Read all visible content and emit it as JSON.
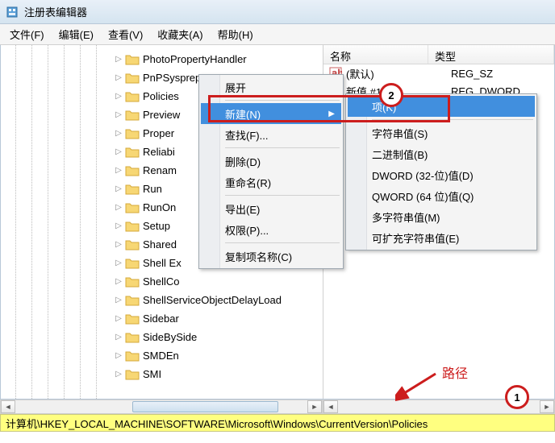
{
  "window": {
    "title": "注册表编辑器"
  },
  "menubar": {
    "file": "文件(F)",
    "edit": "编辑(E)",
    "view": "查看(V)",
    "fav": "收藏夹(A)",
    "help": "帮助(H)"
  },
  "tree": {
    "items": [
      "PhotoPropertyHandler",
      "PnPSysprep",
      "Policies",
      "Preview",
      "Proper",
      "Reliabi",
      "Renam",
      "Run",
      "RunOn",
      "Setup",
      "Shared",
      "Shell Ex",
      "ShellCo",
      "ShellServiceObjectDelayLoad",
      "Sidebar",
      "SideBySide",
      "SMDEn",
      "SMI"
    ],
    "selected_index": 2
  },
  "list": {
    "headers": {
      "name": "名称",
      "type": "类型"
    },
    "rows": [
      {
        "name": "(默认)",
        "type": "REG_SZ",
        "icon": "ab"
      },
      {
        "name": "新值 #1",
        "type": "REG_DWORD",
        "icon": "011"
      }
    ]
  },
  "context_menu_1": {
    "expand": "展开",
    "new": "新建(N)",
    "find": "查找(F)...",
    "delete": "删除(D)",
    "rename": "重命名(R)",
    "export": "导出(E)",
    "permissions": "权限(P)...",
    "copyname": "复制项名称(C)"
  },
  "context_menu_2": {
    "key": "项(K)",
    "string": "字符串值(S)",
    "binary": "二进制值(B)",
    "dword": "DWORD (32-位)值(D)",
    "qword": "QWORD (64 位)值(Q)",
    "multi": "多字符串值(M)",
    "expand": "可扩充字符串值(E)"
  },
  "statusbar": {
    "path": "计算机\\HKEY_LOCAL_MACHINE\\SOFTWARE\\Microsoft\\Windows\\CurrentVersion\\Policies"
  },
  "annotations": {
    "path_label": "路径",
    "n1": "1",
    "n2": "2"
  }
}
